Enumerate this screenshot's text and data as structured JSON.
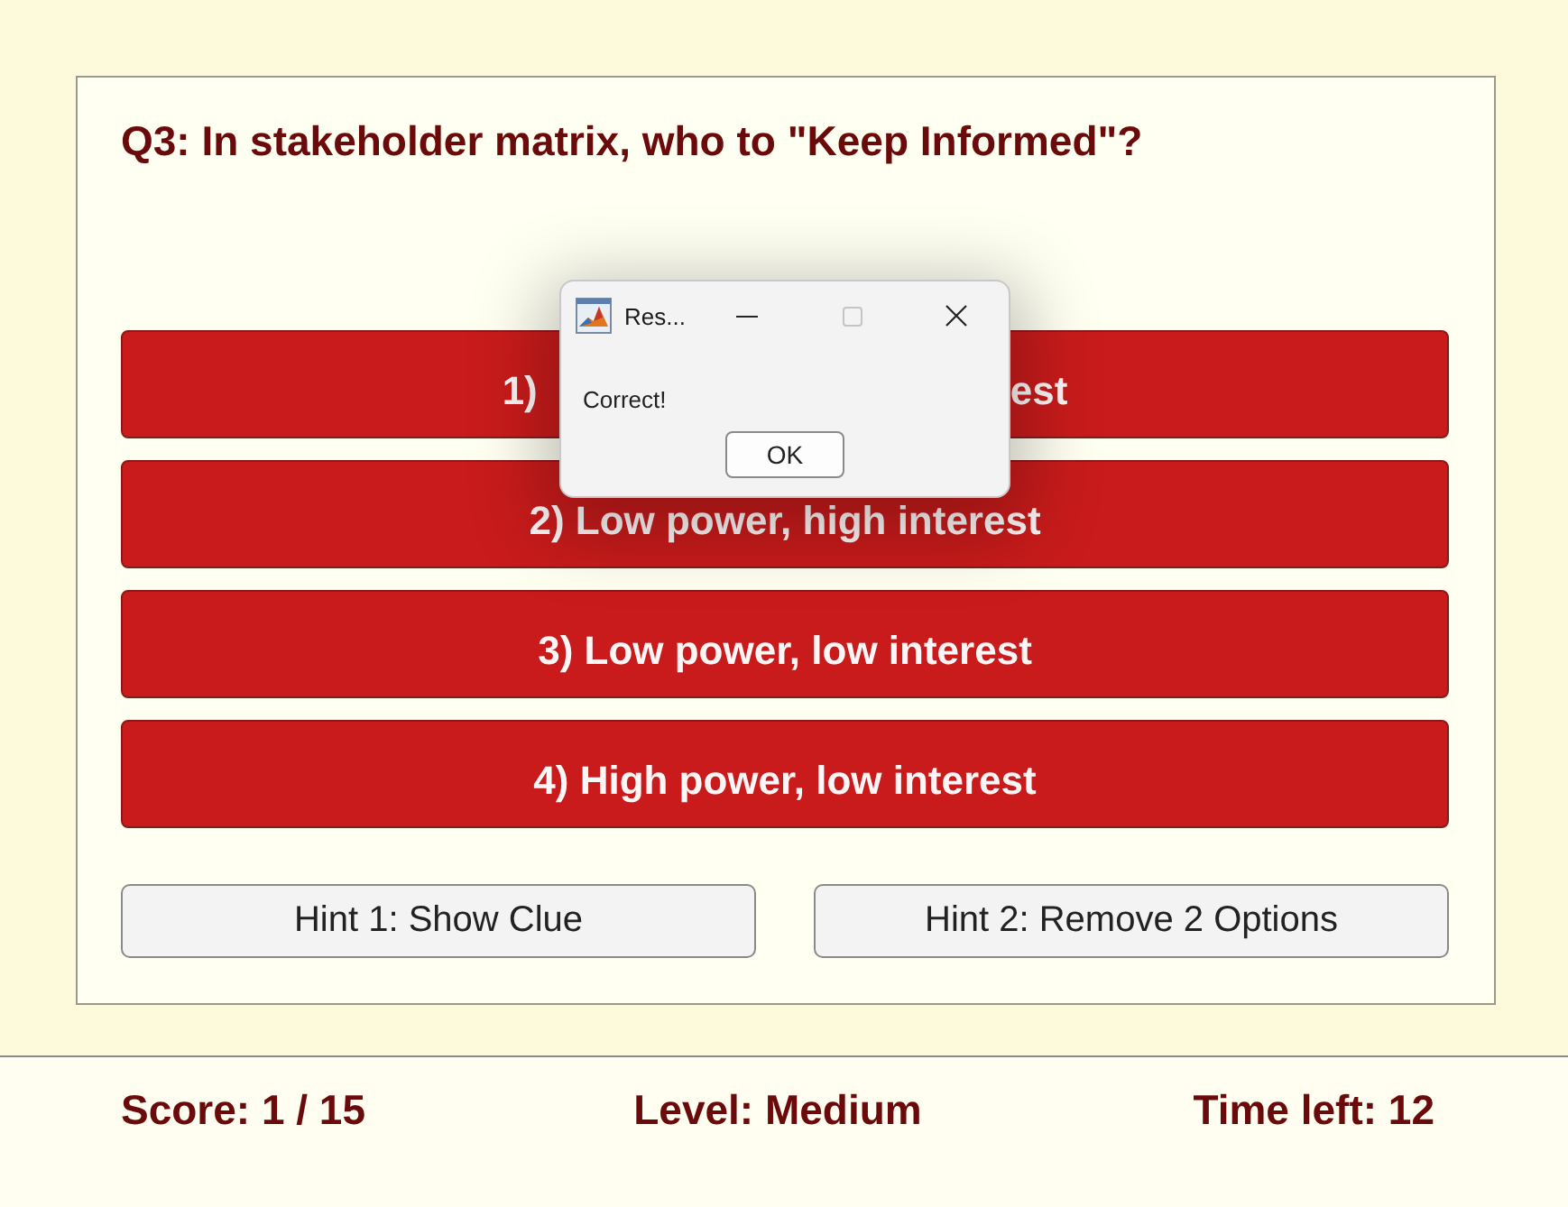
{
  "question": {
    "title": "Q3: In stakeholder matrix, who to \"Keep Informed\"?"
  },
  "answers": [
    {
      "label_parts": [
        "1)",
        "est"
      ]
    },
    {
      "label_parts": [
        "2) Low power, high interest"
      ]
    },
    {
      "label_parts": [
        "3) Low power, low interest"
      ]
    },
    {
      "label_parts": [
        "4) High power, low interest"
      ]
    }
  ],
  "hints": [
    {
      "label": "Hint 1: Show Clue"
    },
    {
      "label": "Hint 2: Remove 2 Options"
    }
  ],
  "status_bar": {
    "score": "Score: 1 / 15",
    "level": "Level: Medium",
    "time_left": "Time left: 12"
  },
  "dialog": {
    "title": "Res...",
    "maximize_disabled": true,
    "message": "Correct!",
    "button": "OK"
  }
}
